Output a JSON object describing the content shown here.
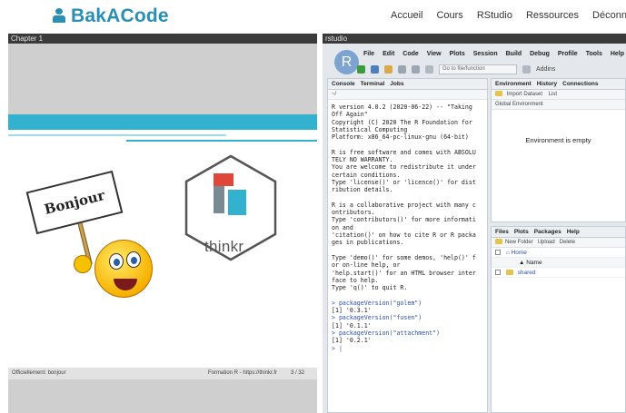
{
  "nav": {
    "brand": "BakACode",
    "links": [
      "Accueil",
      "Cours",
      "RStudio",
      "Ressources",
      "Déconnexion"
    ]
  },
  "slides_panel": {
    "title": "Chapter 1",
    "sign_text": "Bonjour",
    "logo_text": "thinkr",
    "footer_left": "Officiellement: bonjour",
    "footer_right": "Formation R - https://thinkr.fr",
    "page": "3 / 32"
  },
  "rstudio": {
    "title": "rstudio",
    "logo": "R",
    "menu": [
      "File",
      "Edit",
      "Code",
      "View",
      "Plots",
      "Session",
      "Build",
      "Debug",
      "Profile",
      "Tools",
      "Help"
    ],
    "goto_placeholder": "Go to file/function",
    "addins": "Addins",
    "console": {
      "tabs": [
        "Console",
        "Terminal",
        "Jobs"
      ],
      "path": "~/",
      "lines": [
        "R version 4.0.2 (2020-06-22) -- \"Taking",
        "Off Again\"",
        "Copyright (C) 2020 The R Foundation for",
        "Statistical Computing",
        "Platform: x86_64-pc-linux-gnu (64-bit)",
        "",
        "R is free software and comes with ABSOLU",
        "TELY NO WARRANTY.",
        "You are welcome to redistribute it under",
        "certain conditions.",
        "Type 'license()' or 'licence()' for dist",
        "ribution details.",
        "",
        "R is a collaborative project with many c",
        "ontributors.",
        "Type 'contributors()' for more informati",
        "on and",
        "'citation()' on how to cite R or R packa",
        "ges in publications.",
        "",
        "Type 'demo()' for some demos, 'help()' f",
        "or on-line help, or",
        "'help.start()' for an HTML browser inter",
        "face to help.",
        "Type 'q()' to quit R.",
        ""
      ],
      "commands": [
        {
          "cmd": "> packageVersion(\"golem\")",
          "out": "[1] '0.3.1'"
        },
        {
          "cmd": "> packageVersion(\"fusen\")",
          "out": "[1] '0.1.1'"
        },
        {
          "cmd": "> packageVersion(\"attachment\")",
          "out": "[1] '0.2.1'"
        }
      ],
      "prompt": "> "
    },
    "env": {
      "tabs": [
        "Environment",
        "History",
        "Connections"
      ],
      "import": "Import Dataset",
      "list": "List",
      "scope": "Global Environment",
      "empty": "Environment is empty"
    },
    "files": {
      "tabs": [
        "Files",
        "Plots",
        "Packages",
        "Help"
      ],
      "new_folder": "New Folder",
      "upload": "Upload",
      "delete": "Delete",
      "home": "Home",
      "col_name": "Name",
      "rows": [
        "shared"
      ]
    }
  },
  "colors": {
    "brand": "#2a8fb4",
    "slide_accent": "#33b2cf",
    "link": "#2a4fb5"
  }
}
